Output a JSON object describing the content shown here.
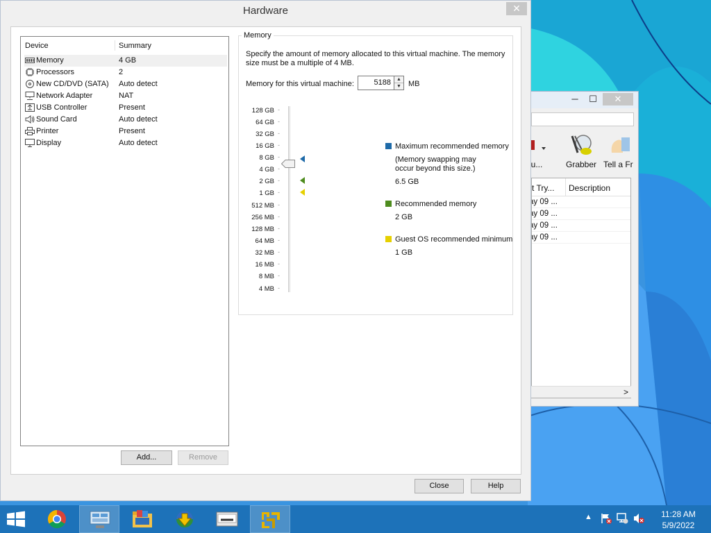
{
  "dialog": {
    "title": "Hardware",
    "close_glyph": "✕",
    "buttons": {
      "close": "Close",
      "help": "Help"
    }
  },
  "device_list": {
    "header_device": "Device",
    "header_summary": "Summary",
    "items": [
      {
        "name": "Memory",
        "summary": "4 GB",
        "icon": "memory-icon"
      },
      {
        "name": "Processors",
        "summary": "2",
        "icon": "processor-icon"
      },
      {
        "name": "New CD/DVD (SATA)",
        "summary": "Auto detect",
        "icon": "cd-dvd-icon"
      },
      {
        "name": "Network Adapter",
        "summary": "NAT",
        "icon": "network-adapter-icon"
      },
      {
        "name": "USB Controller",
        "summary": "Present",
        "icon": "usb-icon"
      },
      {
        "name": "Sound Card",
        "summary": "Auto detect",
        "icon": "speaker-icon"
      },
      {
        "name": "Printer",
        "summary": "Present",
        "icon": "printer-icon"
      },
      {
        "name": "Display",
        "summary": "Auto detect",
        "icon": "monitor-icon"
      }
    ],
    "add_label": "Add...",
    "remove_label": "Remove"
  },
  "memory": {
    "group_label": "Memory",
    "description": "Specify the amount of memory allocated to this virtual machine. The memory size must be a multiple of 4 MB.",
    "field_label": "Memory for this virtual machine:",
    "value": "5188",
    "unit": "MB",
    "scale_labels": [
      "128 GB",
      "64 GB",
      "32 GB",
      "16 GB",
      "8 GB",
      "4 GB",
      "2 GB",
      "1 GB",
      "512 MB",
      "256 MB",
      "128 MB",
      "64 MB",
      "32 MB",
      "16 MB",
      "8 MB",
      "4 MB"
    ],
    "scale_dash": "-",
    "legend": {
      "max_title": "Maximum recommended memory",
      "max_note": "(Memory swapping may occur beyond this size.)",
      "max_value": "6.5 GB",
      "rec_title": "Recommended memory",
      "rec_value": "2 GB",
      "min_title": "Guest OS recommended minimum",
      "min_value": "1 GB"
    },
    "colors": {
      "max": "#1e6aa8",
      "rec": "#4e8c1e",
      "min": "#e6d000"
    }
  },
  "background_window": {
    "tool_partial": "u...",
    "tool_grabber": "Grabber",
    "tool_tell": "Tell a Fr",
    "col_partial": "st Try...",
    "col_description": "Description",
    "rows": [
      "ay 09 ...",
      "ay 09 ...",
      "ay 09 ...",
      "ay 09 ..."
    ],
    "scroll_right": ">"
  },
  "taskbar": {
    "apps": [
      "chrome-icon",
      "remote-desktop-icon",
      "file-explorer-icon",
      "download-manager-icon",
      "adobe-icon",
      "vmware-icon"
    ],
    "tray_chevron": "▲",
    "time": "11:28 AM",
    "date": "5/9/2022"
  }
}
